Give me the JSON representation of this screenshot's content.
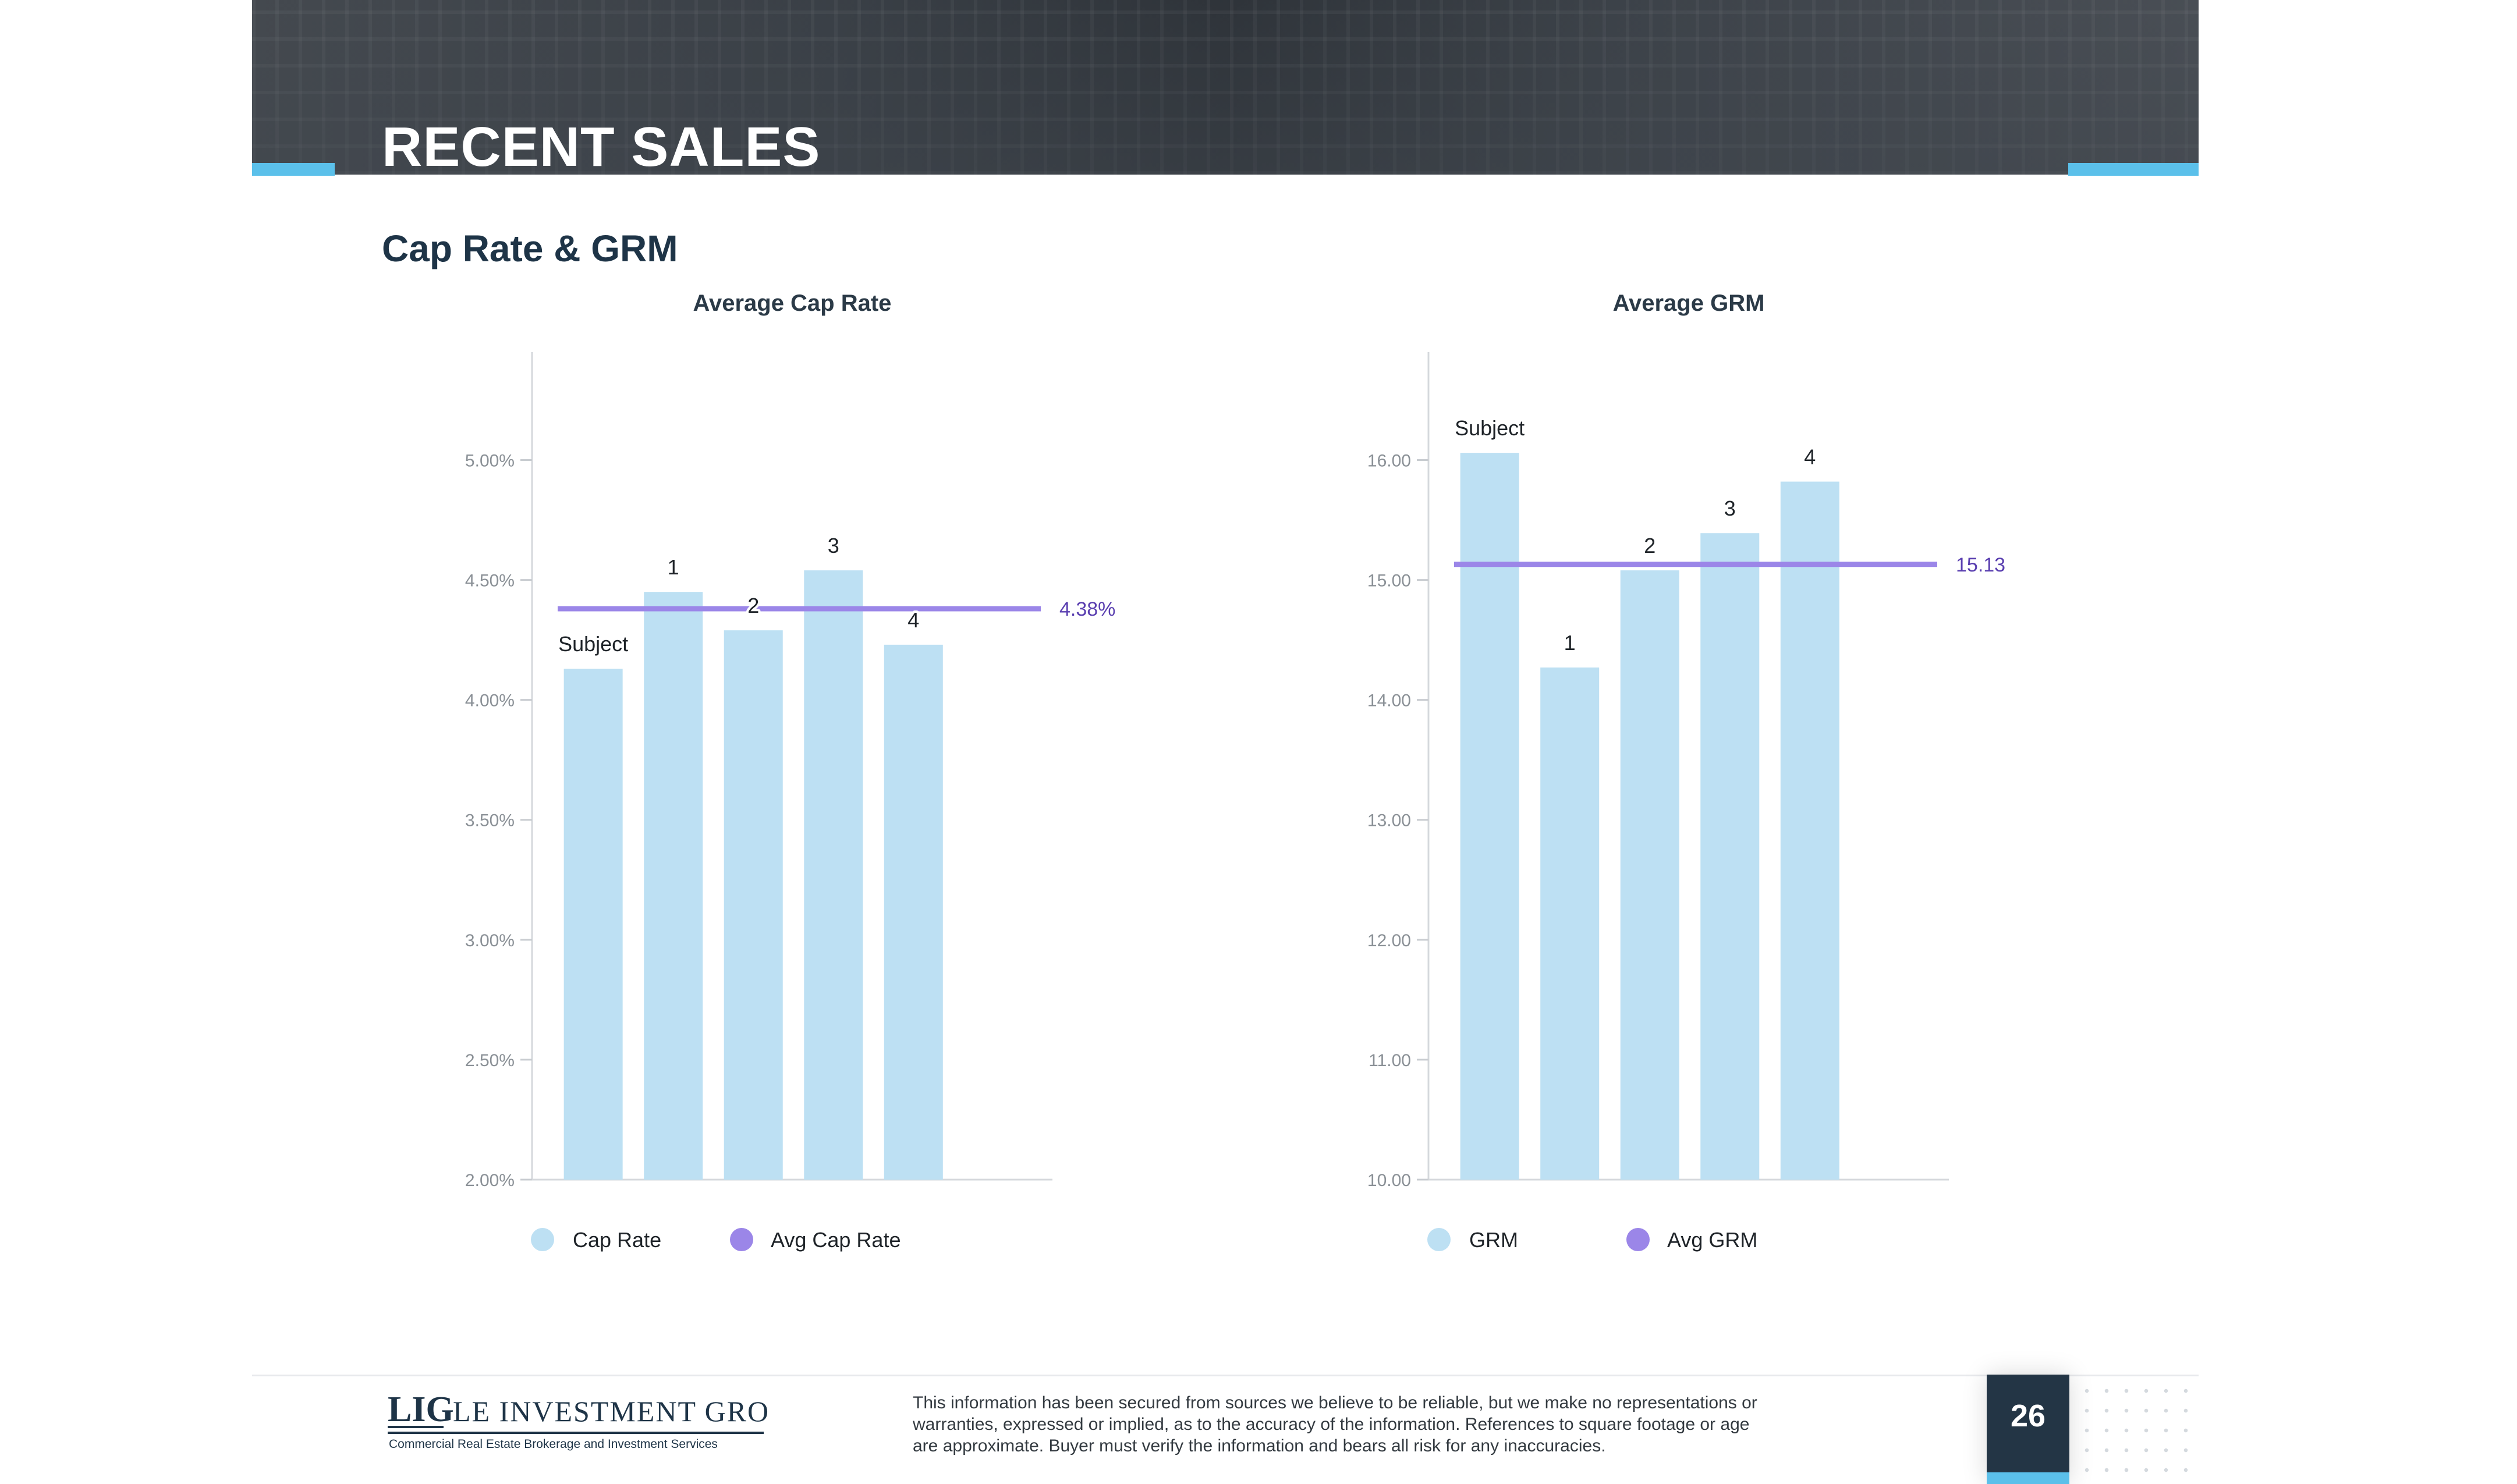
{
  "header": {
    "title": "RECENT SALES"
  },
  "section": {
    "title": "Cap Rate & GRM"
  },
  "colors": {
    "bar": "#bde0f3",
    "avg_line": "#9b86e8",
    "avg_label": "#5a3fb0",
    "accent": "#5bc0ea",
    "navy": "#233545"
  },
  "chart_data": [
    {
      "type": "bar",
      "title": "Average Cap Rate",
      "categories": [
        "Subject",
        "1",
        "2",
        "3",
        "4"
      ],
      "values": [
        4.13,
        4.45,
        4.29,
        4.54,
        4.23
      ],
      "average": 4.38,
      "average_label": "4.38%",
      "ylim": [
        2.0,
        5.45
      ],
      "yticks": [
        2.0,
        2.5,
        3.0,
        3.5,
        4.0,
        4.5,
        5.0
      ],
      "ytick_labels": [
        "2.00%",
        "2.50%",
        "3.00%",
        "3.50%",
        "4.00%",
        "4.50%",
        "5.00%"
      ],
      "series": [
        {
          "name": "Cap Rate"
        },
        {
          "name": "Avg Cap Rate"
        }
      ],
      "legend_position": "bottom-left"
    },
    {
      "type": "bar",
      "title": "Average GRM",
      "categories": [
        "Subject",
        "1",
        "2",
        "3",
        "4"
      ],
      "values": [
        16.06,
        14.27,
        15.08,
        15.39,
        15.82
      ],
      "average": 15.13,
      "average_label": "15.13",
      "ylim": [
        10.0,
        16.9
      ],
      "yticks": [
        10,
        11,
        12,
        13,
        14,
        15,
        16
      ],
      "ytick_labels": [
        "10.00",
        "11.00",
        "12.00",
        "13.00",
        "14.00",
        "15.00",
        "16.00"
      ],
      "series": [
        {
          "name": "GRM"
        },
        {
          "name": "Avg GRM"
        }
      ],
      "legend_position": "bottom-left"
    }
  ],
  "footer": {
    "logo_text": "LIG",
    "logo_company": "Le Investment Group",
    "logo_tagline": "Commercial Real Estate Brokerage and Investment Services",
    "disclaimer_lines": [
      "This information has been secured from sources we believe to be reliable, but we make no representations or",
      "warranties, expressed or implied, as to the accuracy of the information. References to square footage or age",
      "are approximate. Buyer must verify the information and bears all risk for any inaccuracies."
    ],
    "page_number": "26"
  }
}
